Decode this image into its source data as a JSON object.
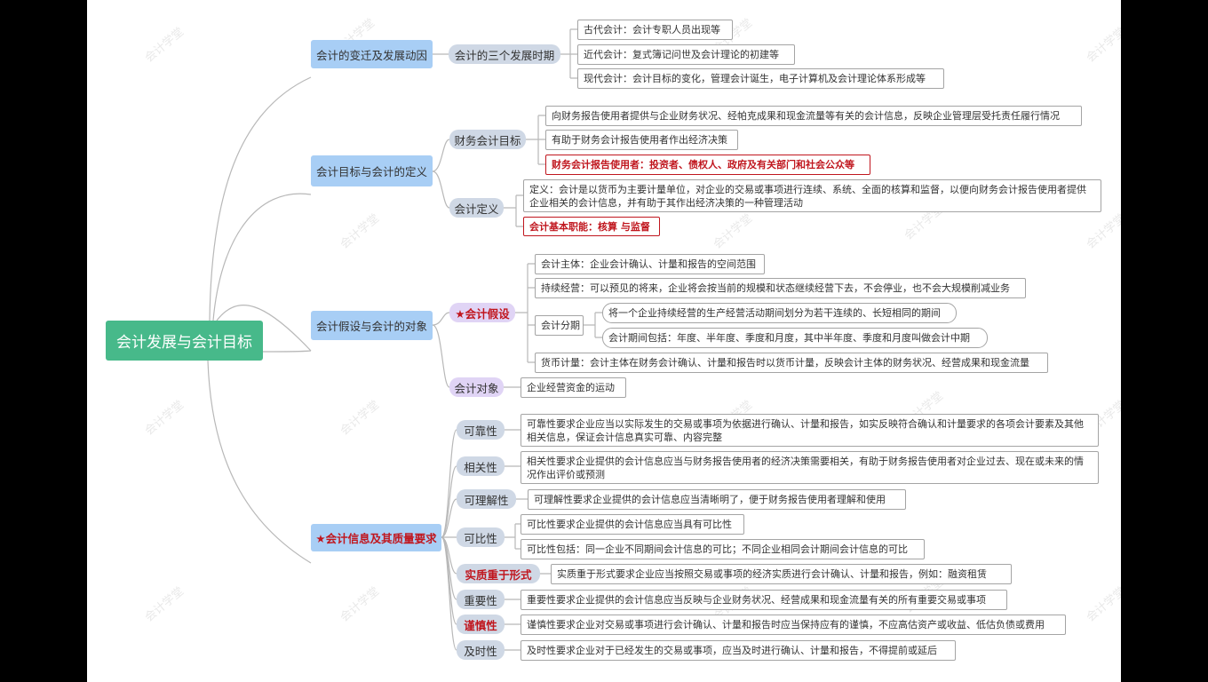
{
  "root": "会计发展与会计目标",
  "branches": {
    "b1": {
      "label": "会计的变迁及发展动因",
      "sub": {
        "label": "会计的三个发展时期",
        "leaves": [
          "古代会计：会计专职人员出现等",
          "近代会计：复式簿记问世及会计理论的初建等",
          "现代会计：会计目标的变化，管理会计诞生，电子计算机及会计理论体系形成等"
        ]
      }
    },
    "b2": {
      "label": "会计目标与会计的定义",
      "sub1": {
        "label": "财务会计目标",
        "leaves": [
          "向财务报告使用者提供与企业财务状况、经帕克成果和现金流量等有关的会计信息，反映企业管理层受托责任履行情况",
          "有助于财务会计报告使用者作出经济决策",
          "财务会计报告使用者：投资者、债权人、政府及有关部门和社会公众等"
        ]
      },
      "sub2": {
        "label": "会计定义",
        "leaves": [
          "定义：会计是以货币为主要计量单位，对企业的交易或事项进行连续、系统、全面的核算和监督，以便向财务会计报告使用者提供企业相关的会计信息，并有助于其作出经济决策的一种管理活动",
          "会计基本职能：核算 与监督"
        ]
      }
    },
    "b3": {
      "label": "会计假设与会计的对象",
      "sub1": {
        "label": "★会计假设",
        "leaves": [
          "会计主体：企业会计确认、计量和报告的空间范围",
          "持续经营：可以预见的将来，企业将会按当前的规模和状态继续经营下去，不会停业，也不会大规模削减业务",
          "会计分期",
          "货币计量：会计主体在财务会计确认、计量和报告时以货币计量，反映会计主体的财务状况、经营成果和现金流量"
        ],
        "period": [
          "将一个企业持续经营的生产经营活动期间划分为若干连续的、长短相同的期间",
          "会计期间包括：年度、半年度、季度和月度，其中半年度、季度和月度叫做会计中期"
        ]
      },
      "sub2": {
        "label": "会计对象",
        "leaves": [
          "企业经营资金的运动"
        ]
      }
    },
    "b4": {
      "label": "★会计信息及其质量要求",
      "items": [
        {
          "label": "可靠性",
          "text": "可靠性要求企业应当以实际发生的交易或事项为依据进行确认、计量和报告，如实反映符合确认和计量要求的各项会计要素及其他相关信息，保证会计信息真实可靠、内容完整"
        },
        {
          "label": "相关性",
          "text": "相关性要求企业提供的会计信息应当与财务报告使用者的经济决策需要相关，有助于财务报告使用者对企业过去、现在或未来的情况作出评价或预测"
        },
        {
          "label": "可理解性",
          "text": "可理解性要求企业提供的会计信息应当清晰明了，便于财务报告使用者理解和使用"
        },
        {
          "label": "可比性",
          "text": "可比性要求企业提供的会计信息应当具有可比性",
          "text2": "可比性包括：同一企业不同期间会计信息的可比；不同企业相同会计期间会计信息的可比"
        },
        {
          "label": "实质重于形式",
          "text": "实质重于形式要求企业应当按照交易或事项的经济实质进行会计确认、计量和报告，例如：融资租赁"
        },
        {
          "label": "重要性",
          "text": "重要性要求企业提供的会计信息应当反映与企业财务状况、经营成果和现金流量有关的所有重要交易或事项"
        },
        {
          "label": "谨慎性",
          "text": "谨慎性要求企业对交易或事项进行会计确认、计量和报告时应当保持应有的谨慎，不应高估资产或收益、低估负债或费用"
        },
        {
          "label": "及时性",
          "text": "及时性要求企业对于已经发生的交易或事项，应当及时进行确认、计量和报告，不得提前或延后"
        }
      ]
    }
  },
  "watermark": "会计学堂",
  "colors": {
    "root": "#47b98a",
    "l1": "#a8cef5",
    "l2": "#cfd8e5",
    "accent": "#c0161e"
  }
}
